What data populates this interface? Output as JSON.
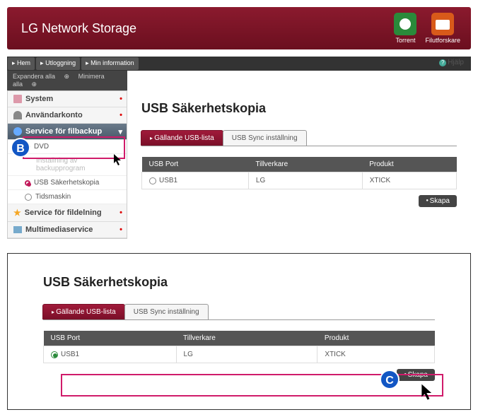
{
  "header": {
    "title": "LG Network Storage",
    "icons": {
      "torrent": "Torrent",
      "explorer": "Filutforskare"
    }
  },
  "topnav": {
    "home": "Hem",
    "logout": "Utloggning",
    "info": "Min information",
    "help": "Hjälp"
  },
  "subbar": {
    "expand": "Expandera alla",
    "minimize": "Minimera alla"
  },
  "sidebar": {
    "system": "System",
    "users": "Användarkonto",
    "backup": "Service för filbackup",
    "dvd": "DVD",
    "app": "Inställning av backupprogram",
    "usb": "USB Säkerhetskopia",
    "time": "Tidsmaskin",
    "share": "Service för fildelning",
    "mm": "Multimediaservice"
  },
  "page": {
    "title": "USB Säkerhetskopia",
    "tab1": "Gällande USB-lista",
    "tab2": "USB Sync inställning",
    "cols": {
      "port": "USB Port",
      "maker": "Tillverkare",
      "product": "Produkt"
    },
    "row": {
      "port": "USB1",
      "maker": "LG",
      "product": "XTICK"
    },
    "create": "Skapa"
  },
  "badges": {
    "b": "B",
    "c": "C"
  }
}
